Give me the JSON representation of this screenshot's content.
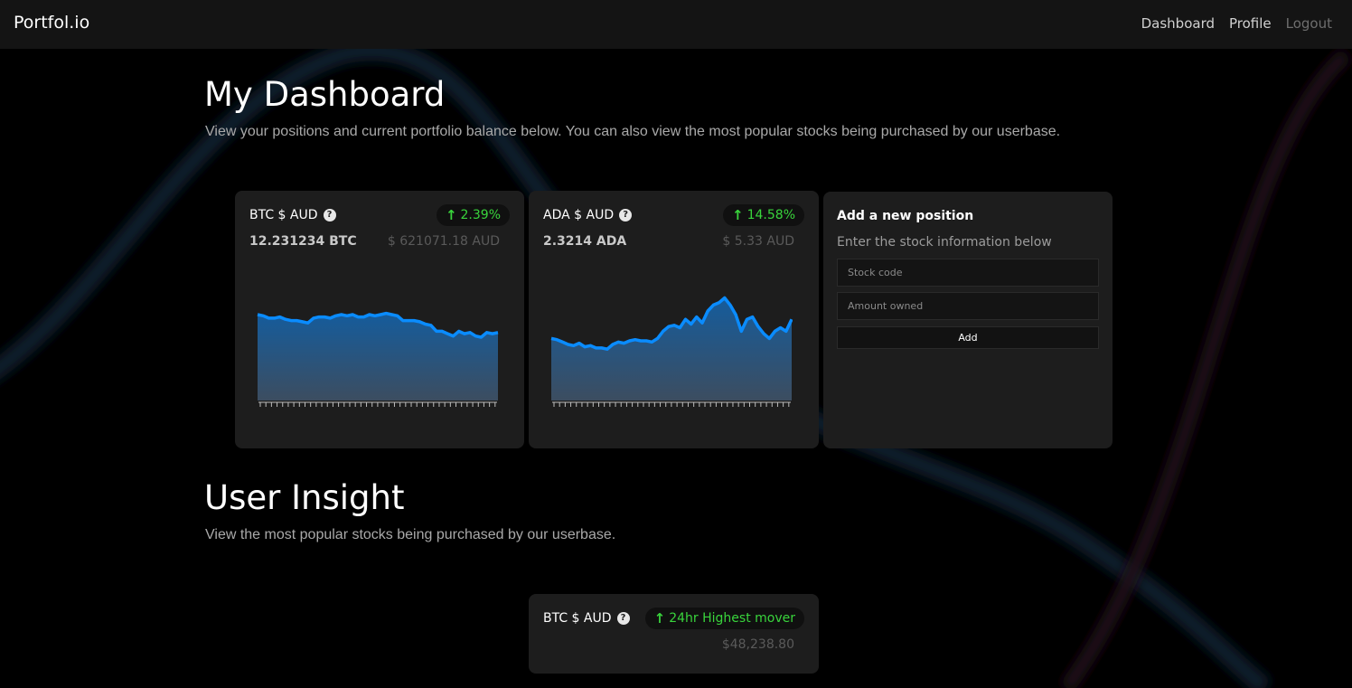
{
  "nav": {
    "brand": "Portfol.io",
    "links": [
      "Dashboard",
      "Profile",
      "Logout"
    ]
  },
  "dashboard": {
    "title": "My Dashboard",
    "description": "View your positions and current portfolio balance below. You can also view the most popular stocks being purchased by our userbase."
  },
  "positions": [
    {
      "title": "BTC $ AUD",
      "change": "2.39%",
      "amount": "12.231234 BTC",
      "value": "$ 621071.18 AUD",
      "series": [
        72,
        71,
        69,
        69,
        70,
        68,
        67,
        67,
        66,
        65,
        69,
        70,
        70,
        69,
        71,
        72,
        71,
        72,
        70,
        70,
        72,
        71,
        72,
        73,
        72,
        71,
        67,
        67,
        67,
        66,
        64,
        63,
        58,
        58,
        56,
        54,
        58,
        56,
        57,
        54,
        53,
        57,
        56,
        57
      ]
    },
    {
      "title": "ADA $ AUD",
      "change": "14.58%",
      "amount": "2.3214 ADA",
      "value": "$ 5.33 AUD",
      "series": [
        52,
        51,
        49,
        47,
        46,
        48,
        45,
        46,
        44,
        44,
        43,
        47,
        49,
        48,
        50,
        51,
        50,
        50,
        49,
        52,
        58,
        62,
        63,
        61,
        68,
        64,
        70,
        65,
        75,
        80,
        82,
        86,
        80,
        72,
        58,
        68,
        70,
        62,
        56,
        52,
        58,
        61,
        58,
        68
      ]
    }
  ],
  "add_form": {
    "title": "Add a new position",
    "subtitle": "Enter the stock information below",
    "stock_code_placeholder": "Stock code",
    "amount_placeholder": "Amount owned",
    "button": "Add"
  },
  "insight": {
    "title": "User Insight",
    "description": "View the most popular stocks being purchased by our userbase.",
    "card": {
      "title": "BTC $ AUD",
      "badge": "24hr Highest mover",
      "price": "$48,238.80"
    }
  },
  "colors": {
    "accent": "#0a8cff",
    "positive": "#39d43c",
    "card_bg": "#1d1d1d",
    "nav_bg": "#141414"
  }
}
